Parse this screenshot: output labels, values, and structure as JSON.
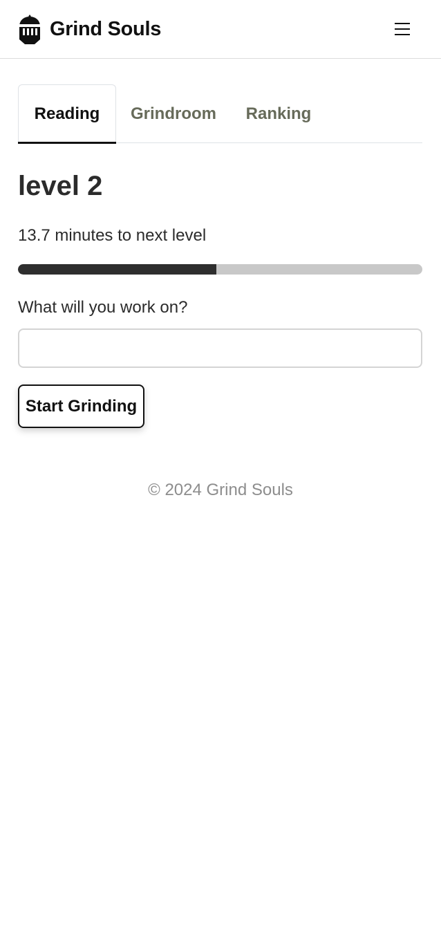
{
  "navbar": {
    "brand_name": "Grind Souls",
    "logo_icon": "knight-helmet-icon",
    "menu_icon": "hamburger-menu-icon"
  },
  "tabs": [
    {
      "label": "Reading",
      "active": true
    },
    {
      "label": "Grindroom",
      "active": false
    },
    {
      "label": "Ranking",
      "active": false
    }
  ],
  "main": {
    "level_title": "level 2",
    "level_info": "13.7 minutes to next level",
    "progress_fraction": 0.49,
    "work_label": "What will you work on?",
    "work_input_value": "",
    "work_input_placeholder": "",
    "start_button_label": "Start Grinding"
  },
  "footer": {
    "copyright": "© 2024 Grind Souls"
  },
  "colors": {
    "text_dark": "#111111",
    "tab_inactive": "#676b5a",
    "progress_fill": "#2e2e2e",
    "progress_track": "#c8c8c8",
    "footer_text": "#8d8d8d"
  }
}
